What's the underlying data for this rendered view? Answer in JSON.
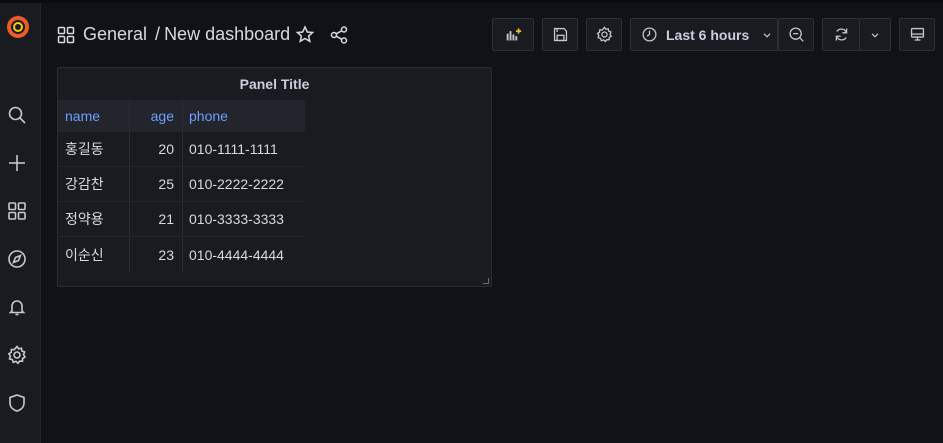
{
  "colors": {
    "background": "#111217",
    "panel": "#181b1f",
    "accent": "#6e9fff",
    "logo": "#f05a28"
  },
  "sidebar": {
    "items": [
      {
        "icon": "search-icon"
      },
      {
        "icon": "plus-icon"
      },
      {
        "icon": "dashboards-icon"
      },
      {
        "icon": "explore-icon"
      },
      {
        "icon": "bell-icon"
      },
      {
        "icon": "gear-icon"
      },
      {
        "icon": "shield-icon"
      }
    ]
  },
  "header": {
    "folder": "General",
    "separator": "/",
    "title": "New dashboard"
  },
  "toolbar": {
    "time_range": "Last 6 hours"
  },
  "panel": {
    "title": "Panel Title",
    "columns": [
      "name",
      "age",
      "phone"
    ],
    "rows": [
      {
        "name": "홍길동",
        "age": "20",
        "phone": "010-1111-1111"
      },
      {
        "name": "강감찬",
        "age": "25",
        "phone": "010-2222-2222"
      },
      {
        "name": "정약용",
        "age": "21",
        "phone": "010-3333-3333"
      },
      {
        "name": "이순신",
        "age": "23",
        "phone": "010-4444-4444"
      }
    ]
  }
}
